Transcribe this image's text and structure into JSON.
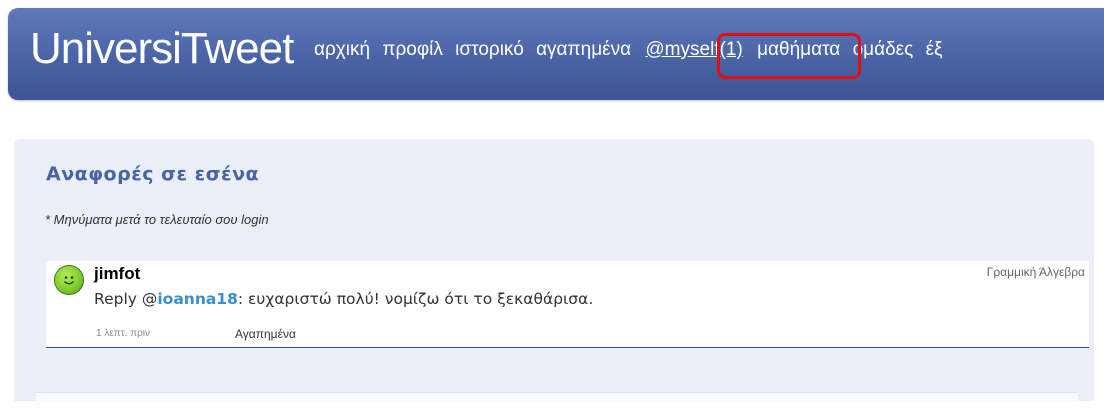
{
  "header": {
    "brand": "UniversiTweet",
    "nav": [
      {
        "label": "αρχική"
      },
      {
        "label": "προφίλ"
      },
      {
        "label": "ιστορικό"
      },
      {
        "label": "αγαπημένα"
      },
      {
        "label": "@myself(1)",
        "highlighted": true
      },
      {
        "label": "μαθήματα"
      },
      {
        "label": "ομάδες"
      },
      {
        "label": "έξ"
      }
    ]
  },
  "panel": {
    "title": "Αναφορές σε εσένα",
    "note": "* Μηνύματα μετά το τελευταίο σου login"
  },
  "tweet": {
    "username": "jimfot",
    "course": "Γραμμική Άλγεβρα",
    "prefix": "Reply @",
    "mention": "ioanna18",
    "text": ": ευχαριστώ πολύ! νομίζω ότι το ξεκαθάρισα.",
    "time": "1 λεπτ. πριν",
    "favorite_label": "Αγαπημένα"
  },
  "colors": {
    "header": "#4a63a7",
    "panel": "#e9eef7",
    "title": "#4a63a7",
    "highlight": "#e01010",
    "mention": "#3b8dd0"
  },
  "icons": {
    "avatar": "smiley-avatar-icon"
  }
}
